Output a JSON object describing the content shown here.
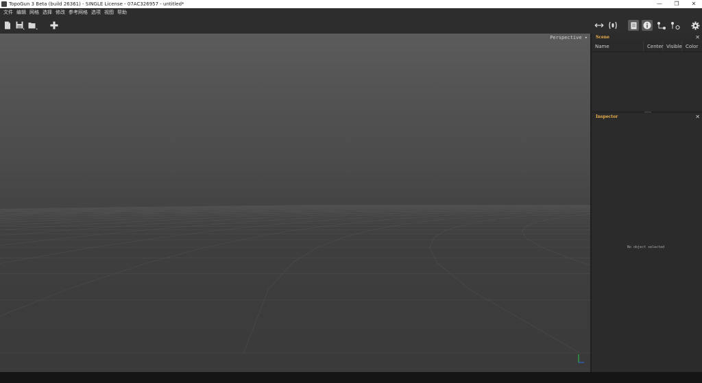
{
  "window": {
    "title": "TopoGun 3 Beta (build 26361) - SINGLE License - 07AC326957 - untitled*",
    "minimize": "—",
    "maximize": "❐",
    "close": "✕"
  },
  "menu": [
    "文件",
    "编辑",
    "网格",
    "选择",
    "修改",
    "参考网格",
    "选项",
    "视图",
    "帮助"
  ],
  "toolbar": {
    "left_icons": [
      "new-file-icon",
      "save-icon",
      "open-folder-icon",
      "add-icon"
    ],
    "right_icons": [
      "move-arrows-icon",
      "brackets-icon",
      "document-icon",
      "info-icon",
      "vertex-swap-icon",
      "vertex-link-icon",
      "gear-icon"
    ]
  },
  "viewport": {
    "camera_label": "Perspective ▾"
  },
  "scene_panel": {
    "title": "Scene",
    "columns": [
      "Name",
      "Center",
      "Visible",
      "Color"
    ]
  },
  "inspector_panel": {
    "title": "Inspector",
    "empty_message": "No object selected"
  },
  "colors": {
    "panel_title": "#f0b24d",
    "active_tool": "#5a5a5a",
    "axis_x": "#2e66c9",
    "axis_y": "#31b34a"
  }
}
